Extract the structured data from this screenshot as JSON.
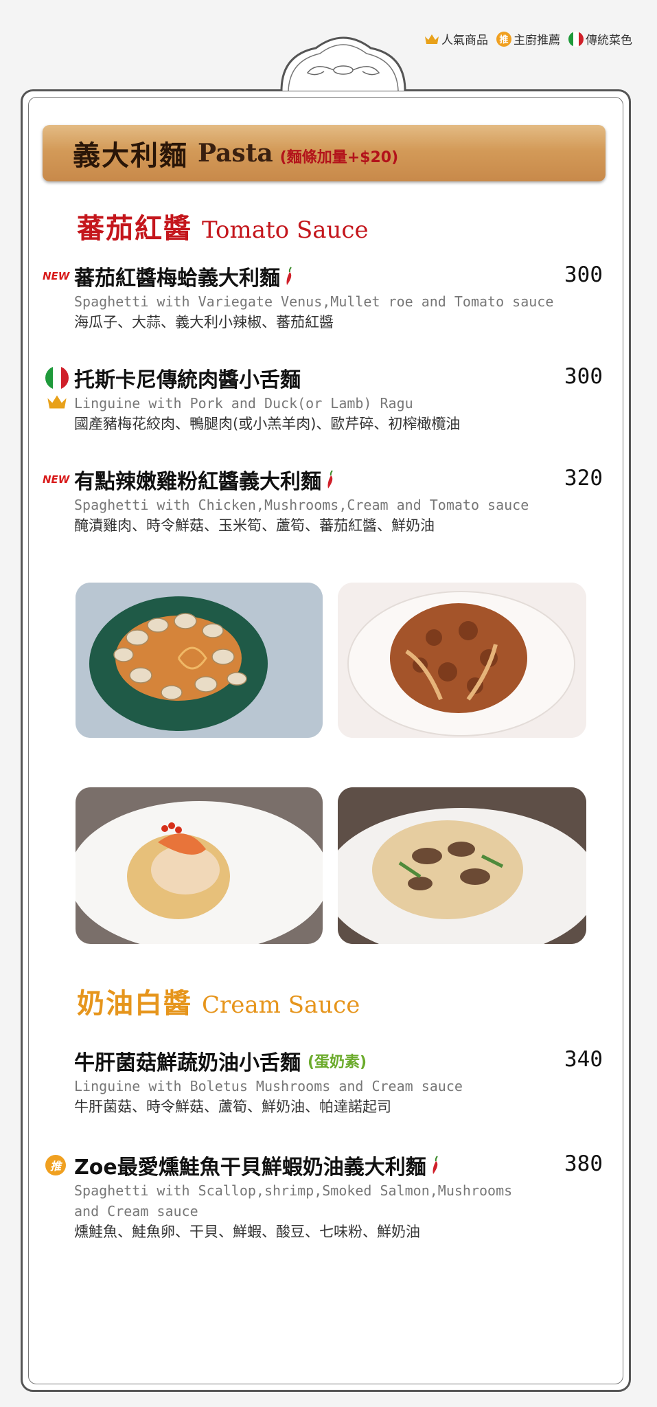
{
  "legend": {
    "popular": "人氣商品",
    "chef": "主廚推薦",
    "chef_mark": "推",
    "traditional": "傳統菜色"
  },
  "banner": {
    "zh": "義大利麵",
    "en": "Pasta",
    "extra": "(麵條加量+$20)"
  },
  "sections": {
    "tomato": {
      "zh": "蕃茄紅醬",
      "en": "Tomato Sauce"
    },
    "cream": {
      "zh": "奶油白醬",
      "en": "Cream Sauce"
    }
  },
  "new_label": "NEW",
  "items": [
    {
      "name": "蕃茄紅醬梅蛤義大利麵",
      "price": "300",
      "en": "Spaghetti with Variegate Venus,Mullet roe and Tomato sauce",
      "ing": "海瓜子、大蒜、義大利小辣椒、蕃茄紅醬"
    },
    {
      "name": "托斯卡尼傳統肉醬小舌麵",
      "price": "300",
      "en": "Linguine with Pork and Duck(or Lamb) Ragu",
      "ing": "國產豬梅花絞肉、鴨腿肉(或小羔羊肉)、歐芹碎、初榨橄欖油"
    },
    {
      "name": "有點辣嫩雞粉紅醬義大利麵",
      "price": "320",
      "en": "Spaghetti with Chicken,Mushrooms,Cream and Tomato sauce",
      "ing": "醃漬雞肉、時令鮮菇、玉米筍、蘆筍、蕃茄紅醬、鮮奶油"
    },
    {
      "name": "牛肝菌菇鮮蔬奶油小舌麵",
      "tag": "(蛋奶素)",
      "price": "340",
      "en": "Linguine with Boletus Mushrooms and Cream sauce",
      "ing": "牛肝菌菇、時令鮮菇、蘆筍、鮮奶油、帕達諾起司"
    },
    {
      "name": "Zoe最愛燻鮭魚干貝鮮蝦奶油義大利麵",
      "price": "380",
      "en": "Spaghetti with Scallop,shrimp,Smoked Salmon,Mushrooms and Cream sauce",
      "ing": "燻鮭魚、鮭魚卵、干貝、鮮蝦、酸豆、七味粉、鮮奶油"
    }
  ],
  "colors": {
    "accent_red": "#c4161c",
    "accent_orange": "#e6951c",
    "veg_green": "#6bab2b",
    "wood": "#d39a58"
  },
  "icons": [
    "crown-icon",
    "chef-recommend-icon",
    "italy-flag-icon",
    "chili-pepper-icon"
  ]
}
